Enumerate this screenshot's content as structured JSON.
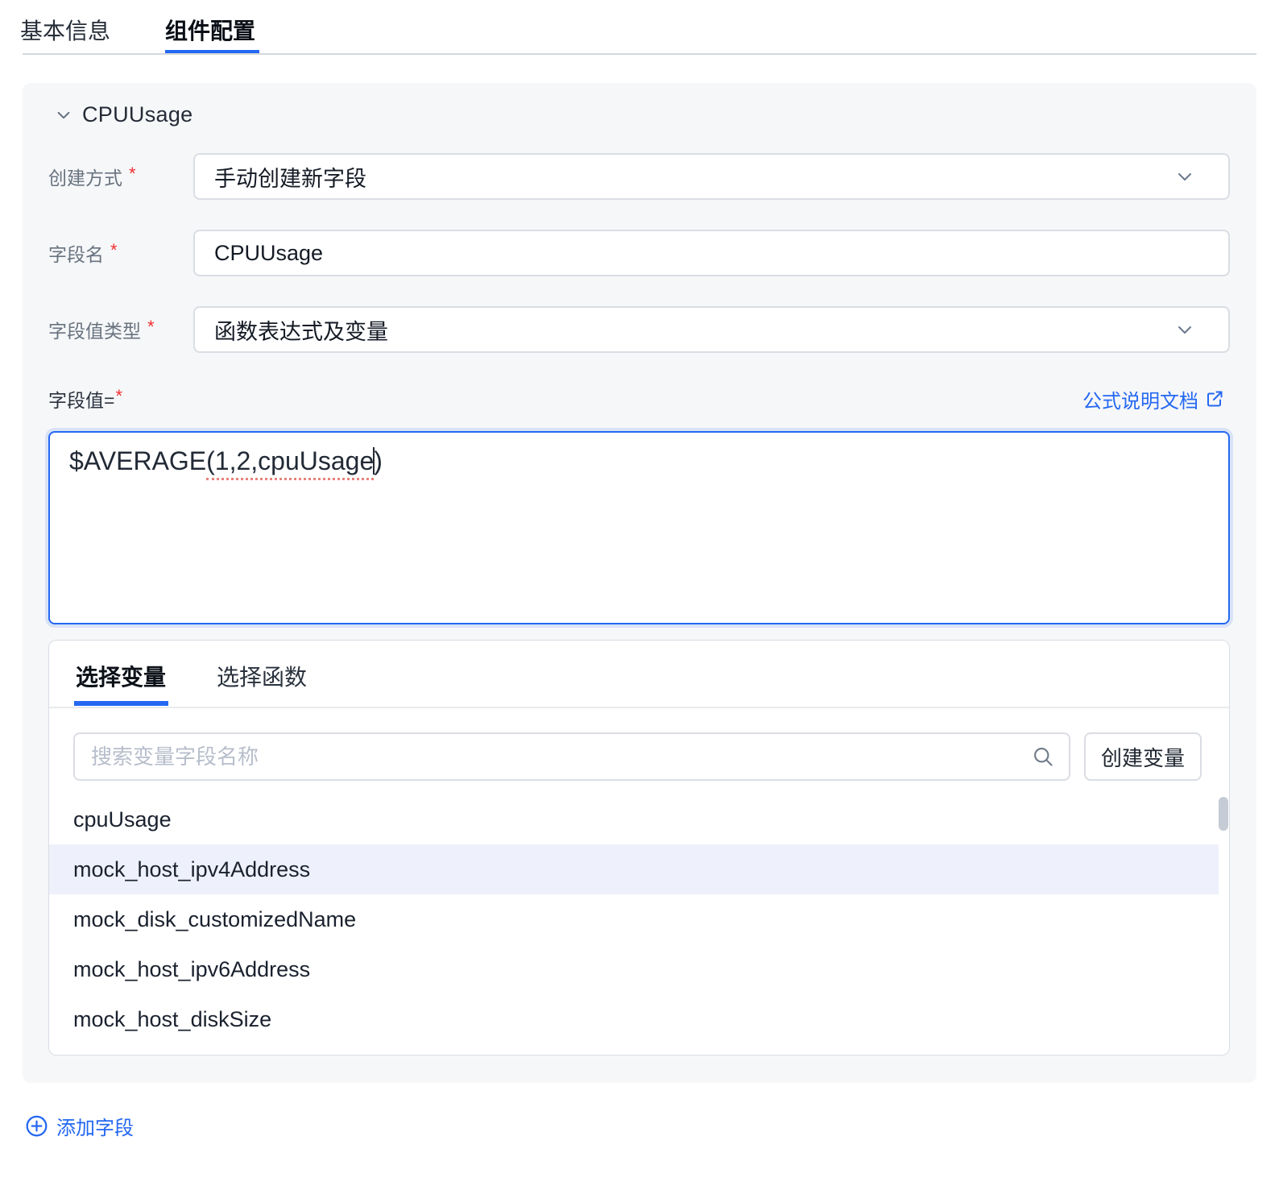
{
  "colors": {
    "accent": "#2468f2",
    "section_bg": "#f6f7f9",
    "highlight_row": "#eef1fb",
    "required": "#f23030",
    "squiggle": "#e8837b"
  },
  "top_tabs": {
    "basic": "基本信息",
    "component": "组件配置"
  },
  "required_mark": "*",
  "section": {
    "title": "CPUUsage",
    "rows": [
      {
        "label": "创建方式",
        "value": "手动创建新字段"
      },
      {
        "label": "字段名",
        "value": "CPUUsage"
      },
      {
        "label": "字段值类型",
        "value": "函数表达式及变量"
      }
    ],
    "field_value": {
      "label": "字段值=",
      "doc_link": "公式说明文档",
      "formula": {
        "lead": "$AVERAGE",
        "marked": "(1,2,cpuUsage",
        "tail": ")"
      }
    }
  },
  "panel": {
    "tabs": {
      "variables": "选择变量",
      "functions": "选择函数"
    },
    "search_placeholder": "搜索变量字段名称",
    "create_button": "创建变量",
    "variables": [
      "cpuUsage",
      "mock_host_ipv4Address",
      "mock_disk_customizedName",
      "mock_host_ipv6Address",
      "mock_host_diskSize"
    ],
    "selected_variable": "mock_host_ipv4Address"
  },
  "footer": {
    "add_field": "添加字段"
  }
}
